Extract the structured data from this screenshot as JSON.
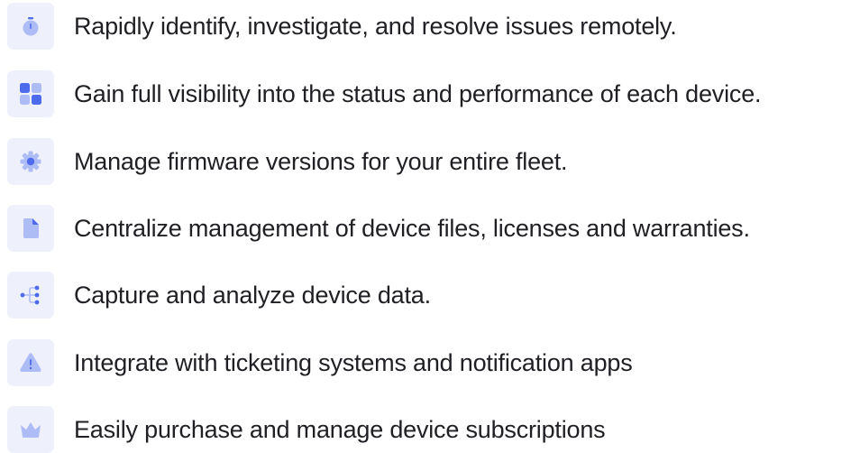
{
  "features": [
    {
      "icon": "stopwatch-icon",
      "text": "Rapidly identify, investigate, and resolve issues remotely."
    },
    {
      "icon": "dashboard-grid-icon",
      "text": "Gain full visibility into the status and performance of each device."
    },
    {
      "icon": "gear-icon",
      "text": "Manage firmware versions for your entire fleet."
    },
    {
      "icon": "document-icon",
      "text": "Centralize management of device files, licenses and warranties."
    },
    {
      "icon": "data-flow-icon",
      "text": "Capture and analyze device data."
    },
    {
      "icon": "warning-triangle-icon",
      "text": "Integrate with ticketing systems and notification apps"
    },
    {
      "icon": "crown-icon",
      "text": "Easily purchase and manage device subscriptions"
    }
  ],
  "colors": {
    "icon_primary": "#4f6bed",
    "icon_light": "#aebcf6",
    "tile_background": "#eef0fb",
    "text": "#1f1f24"
  }
}
